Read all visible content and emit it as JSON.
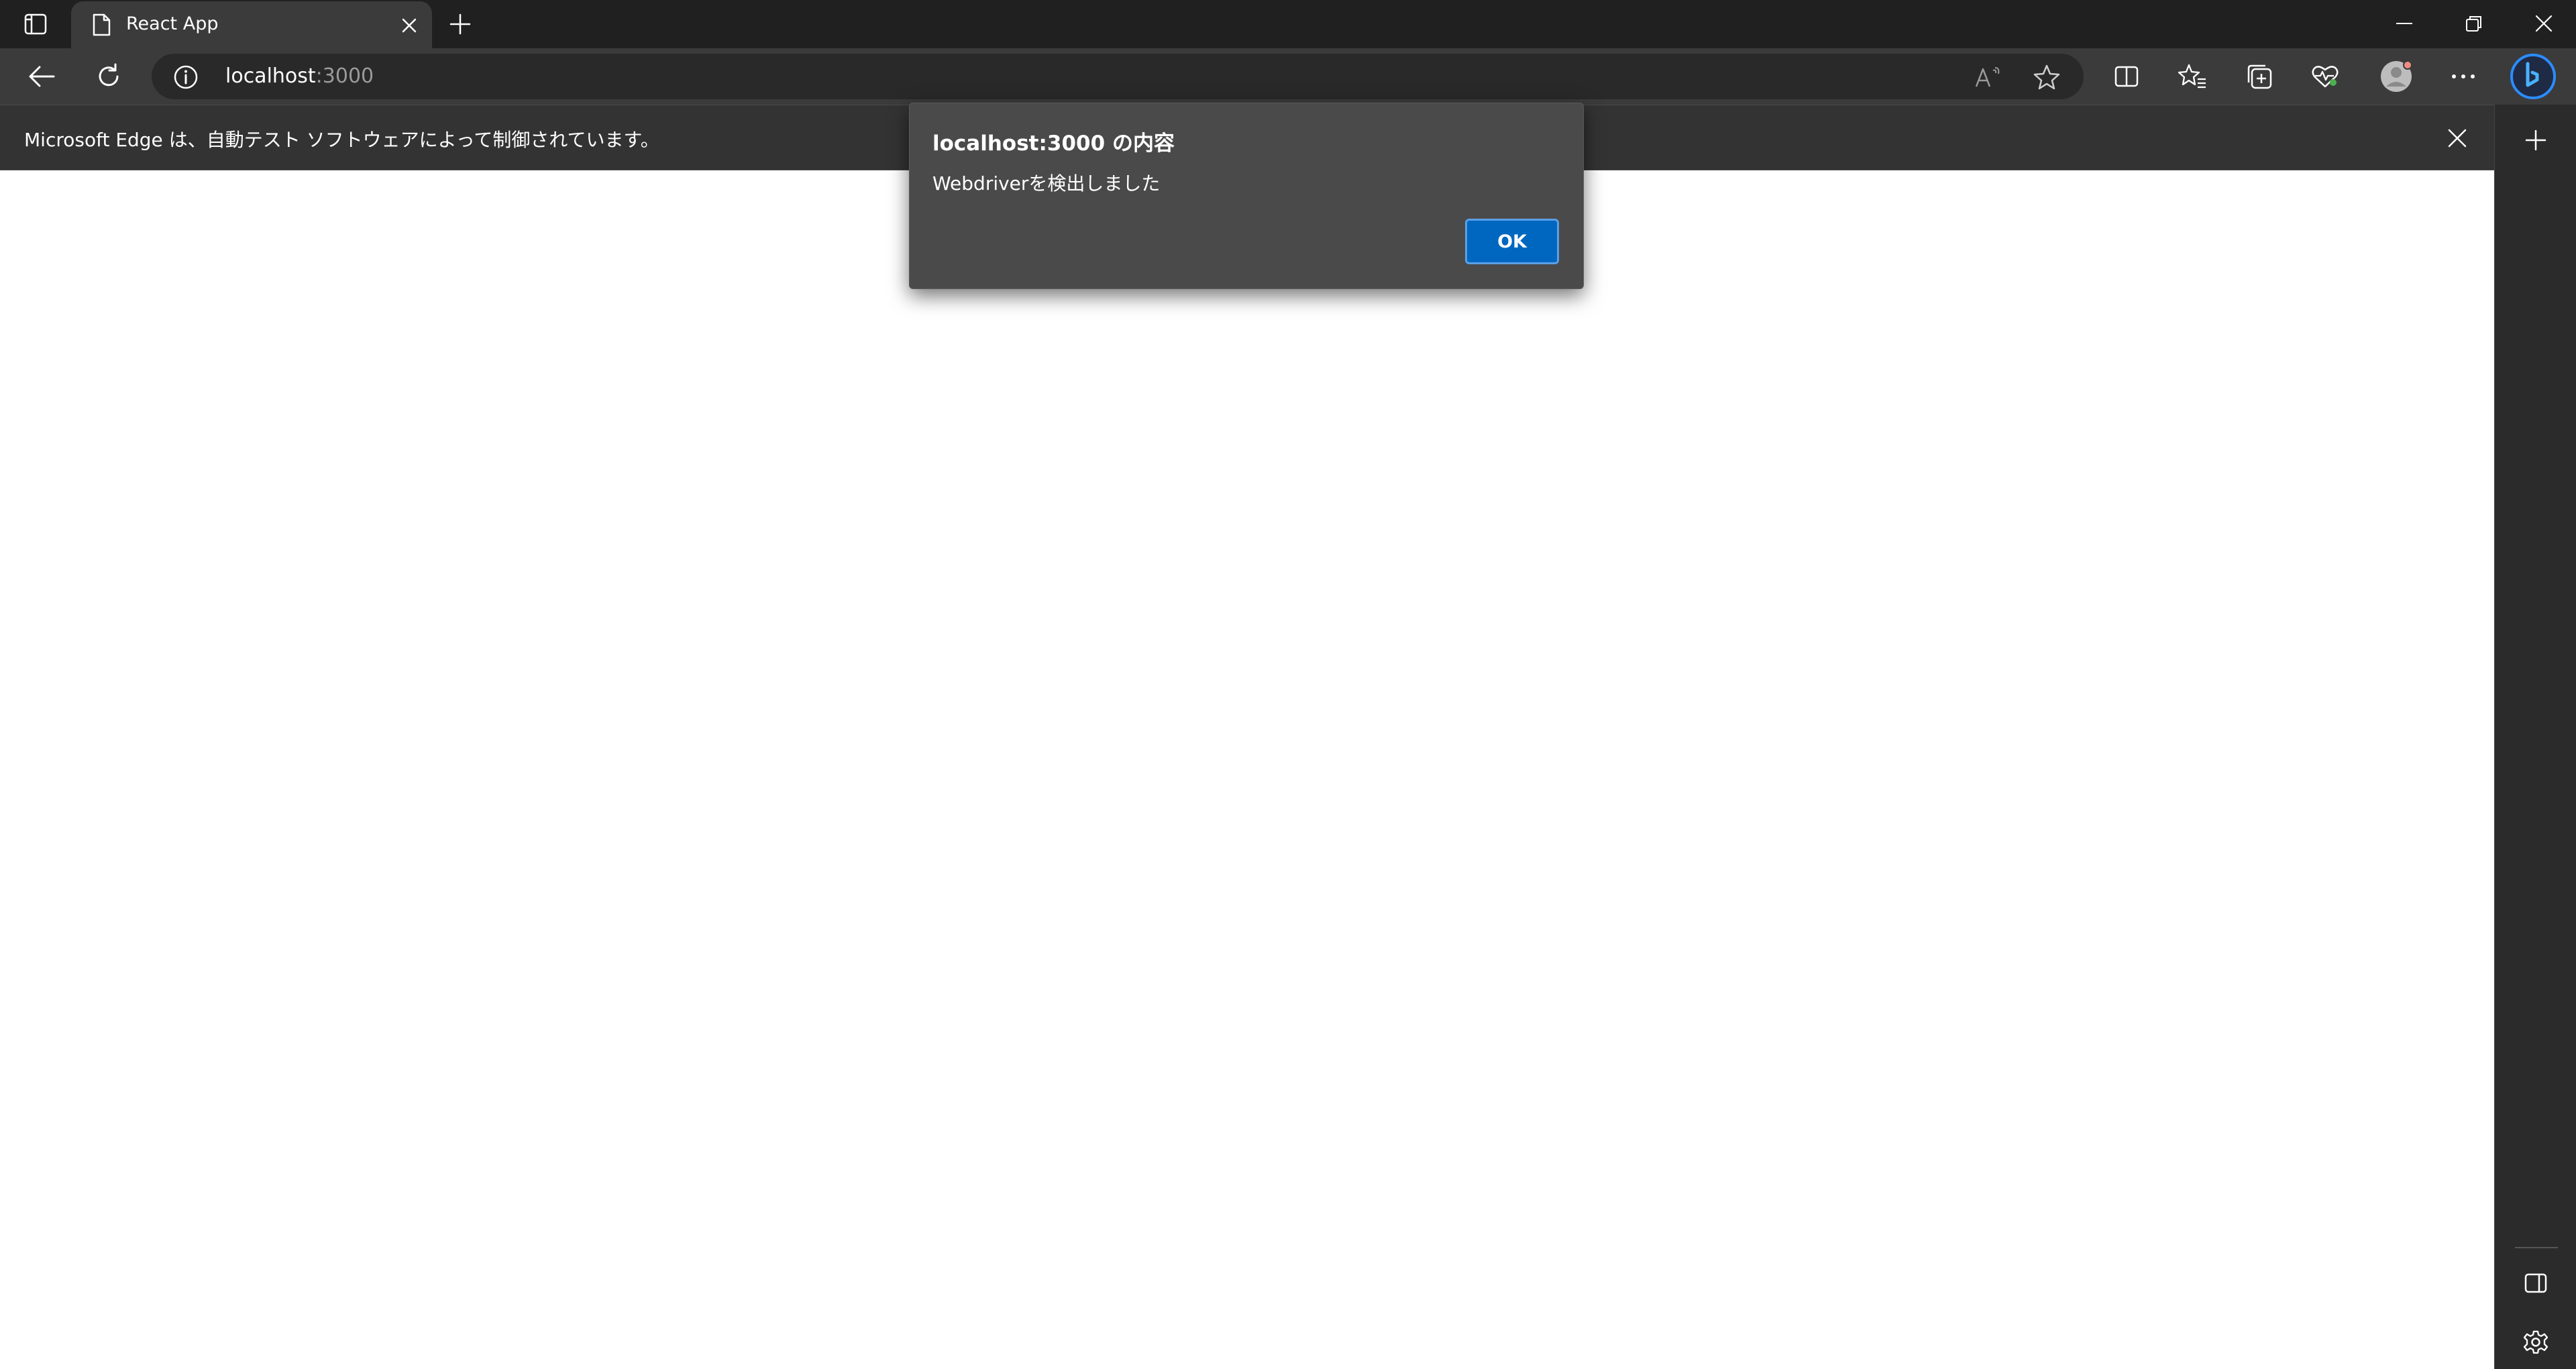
{
  "browser": {
    "tab": {
      "title": "React App"
    },
    "address_bar": {
      "host": "localhost",
      "port": ":3000"
    },
    "infobar": {
      "message": "Microsoft Edge は、自動テスト ソフトウェアによって制御されています。"
    }
  },
  "dialog": {
    "title": "localhost:3000 の内容",
    "message": "Webdriverを検出しました",
    "ok_label": "OK"
  },
  "colors": {
    "accent": "#0067c0",
    "titlebar": "#202020",
    "toolbar": "#3b3b3b",
    "dialog_bg": "#4a4a4a"
  },
  "icons": {
    "tab_actions": "tab-actions-icon",
    "favicon": "page-icon",
    "tab_close": "close-icon",
    "new_tab": "plus-icon",
    "back": "arrow-left-icon",
    "reload": "refresh-icon",
    "site_info": "info-icon",
    "read_aloud": "read-aloud-icon",
    "favorite": "star-icon",
    "split_screen": "split-screen-icon",
    "favorites": "favorites-list-icon",
    "collections": "collections-icon",
    "browser_essentials": "heart-pulse-icon",
    "profile": "avatar-icon",
    "more": "ellipsis-icon",
    "copilot": "bing-icon",
    "sidebar_add": "plus-icon",
    "sidebar_panel": "sidebar-panel-icon",
    "settings": "gear-icon"
  }
}
